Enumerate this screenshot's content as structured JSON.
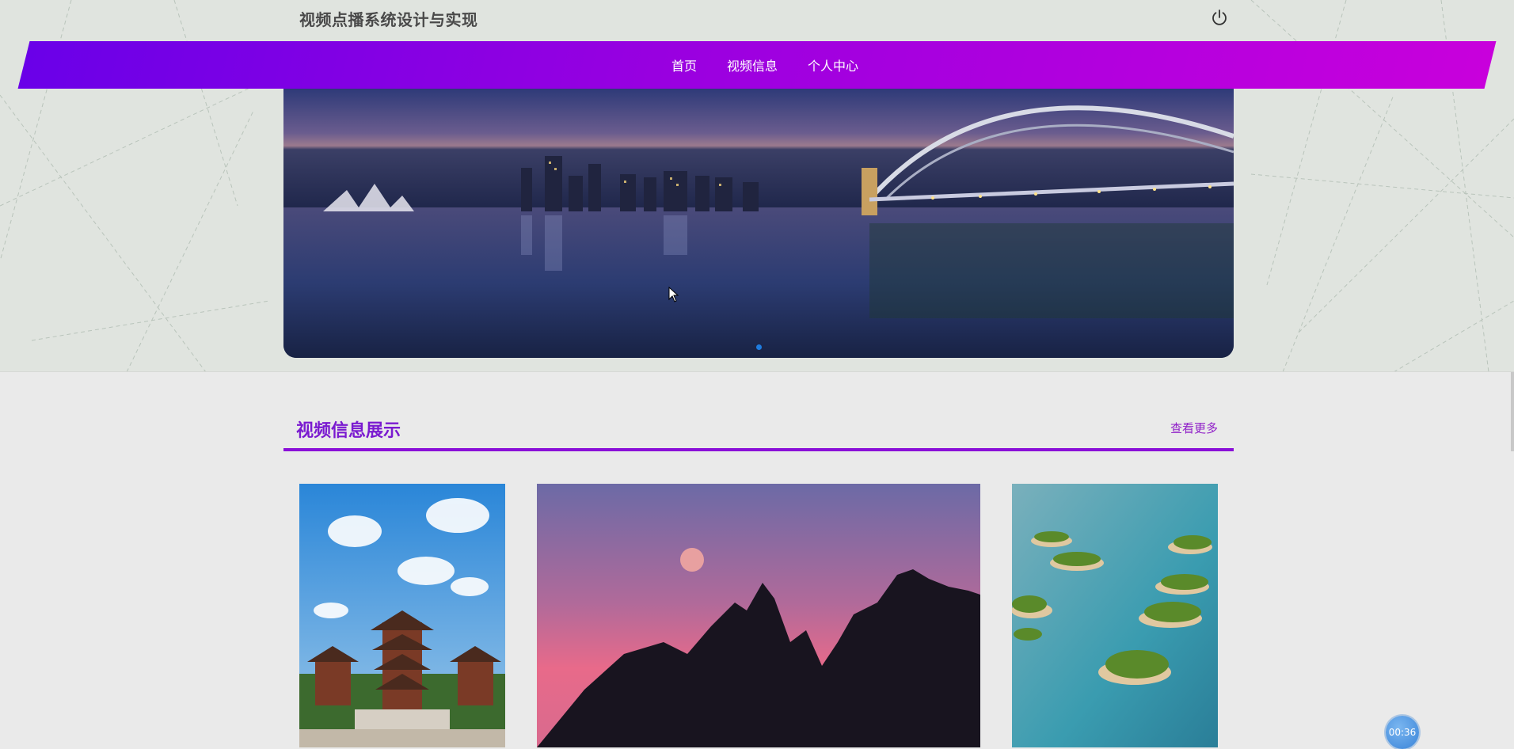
{
  "header": {
    "site_title": "视频点播系统设计与实现",
    "logout_icon": "power-icon"
  },
  "nav": {
    "items": [
      {
        "label": "首页"
      },
      {
        "label": "视频信息"
      },
      {
        "label": "个人中心"
      }
    ],
    "gradient_start": "#6a00e8",
    "gradient_end": "#c800dc"
  },
  "banner": {
    "dot_count": 1,
    "active_dot": 0
  },
  "section": {
    "title": "视频信息展示",
    "more_label": "查看更多",
    "accent_color": "#8a10d8"
  },
  "cards": [
    {
      "icon": "pagoda-temple-image"
    },
    {
      "icon": "mountain-moon-image"
    },
    {
      "icon": "islands-lake-image"
    }
  ],
  "timer": {
    "label": "00:36"
  }
}
